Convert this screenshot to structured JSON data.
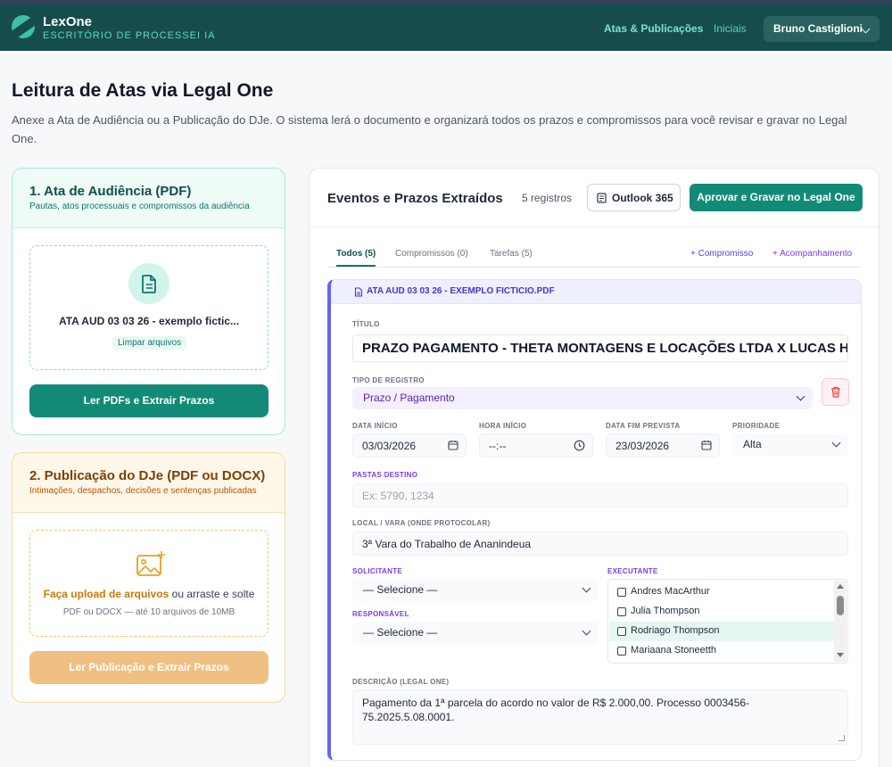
{
  "header": {
    "brand": "LexOne",
    "brand_sub": "ESCRITÓRIO DE PROCESSEI IA",
    "nav": [
      "Atas & Publicações",
      "Iniciais"
    ],
    "user": "Bruno Castiglioni"
  },
  "page": {
    "title": "Leitura de Atas via Legal One",
    "description": "Anexe a Ata de Audiência ou a Publicação do DJe. O sistema lerá o documento e organizará todos os prazos e compromissos para você revisar e gravar no Legal One."
  },
  "ata_card": {
    "title": "1. Ata de Audiência (PDF)",
    "subtitle": "Pautas, atos processuais e compromissos da audiência",
    "file_name": "ATA AUD 03 03 26 - exemplo fictic...",
    "clear_label": "Limpar arquivos",
    "button": "Ler PDFs e Extrair Prazos"
  },
  "dje_card": {
    "title": "2. Publicação do DJe (PDF ou DOCX)",
    "subtitle": "Intimações, despachos, decisões e sentenças publicadas",
    "upload_link": "Faça upload de arquivos",
    "upload_rest": " ou arraste e solte",
    "hint": "PDF ou DOCX — até 10 arquivos de 10MB",
    "button": "Ler Publicação e Extrair Prazos"
  },
  "events": {
    "title": "Eventos e Prazos Extraídos",
    "count": "5 registros",
    "outlook_btn": "Outlook 365",
    "approve_btn": "Aprovar e Gravar no Legal One",
    "tabs": [
      "Todos (5)",
      "Compromissos (0)",
      "Tarefas (5)"
    ],
    "actions": [
      "+ Compromisso",
      "+ Acompanhamento"
    ]
  },
  "event": {
    "file": "ATA AUD 03 03 26 - EXEMPLO FICTICIO.PDF",
    "labels": {
      "titulo": "TÍTULO",
      "tipo": "TIPO DE REGISTRO",
      "data_inicio": "DATA INÍCIO",
      "hora_inicio": "HORA INÍCIO",
      "data_fim": "DATA FIM PREVISTA",
      "prioridade": "PRIORIDADE",
      "pastas": "PASTAS DESTINO",
      "local": "LOCAL / VARA (ONDE PROTOCOLAR)",
      "solicitante": "SOLICITANTE",
      "executante": "EXECUTANTE",
      "responsavel": "RESPONSÁVEL",
      "descricao": "DESCRIÇÃO (LEGAL ONE)"
    },
    "titulo": "PRAZO PAGAMENTO - THETA MONTAGENS E LOCAÇÕES LTDA X LUCAS HENRIQUE",
    "tipo": "Prazo / Pagamento",
    "data_inicio": "03/03/2026",
    "hora_inicio": "--:--",
    "data_fim": "23/03/2026",
    "prioridade": "Alta",
    "pastas_placeholder": "Ex: 5790, 1234",
    "local": "3ª Vara do Trabalho de Ananindeua",
    "solicitante": "— Selecione —",
    "responsavel": "— Selecione —",
    "executantes": [
      "Andres MacArthur",
      "Julia Thompson",
      "Rodriago Thompson",
      "Mariaana Stoneetth"
    ],
    "descricao": "Pagamento da 1ª parcela do acordo no valor de R$ 2.000,00. Processo 0003456-75.2025.5.08.0001."
  },
  "colors": {
    "header_bg": "#164d4c",
    "primary": "#138a77",
    "accent_purple": "#6366f1",
    "amber": "#f0c083"
  }
}
